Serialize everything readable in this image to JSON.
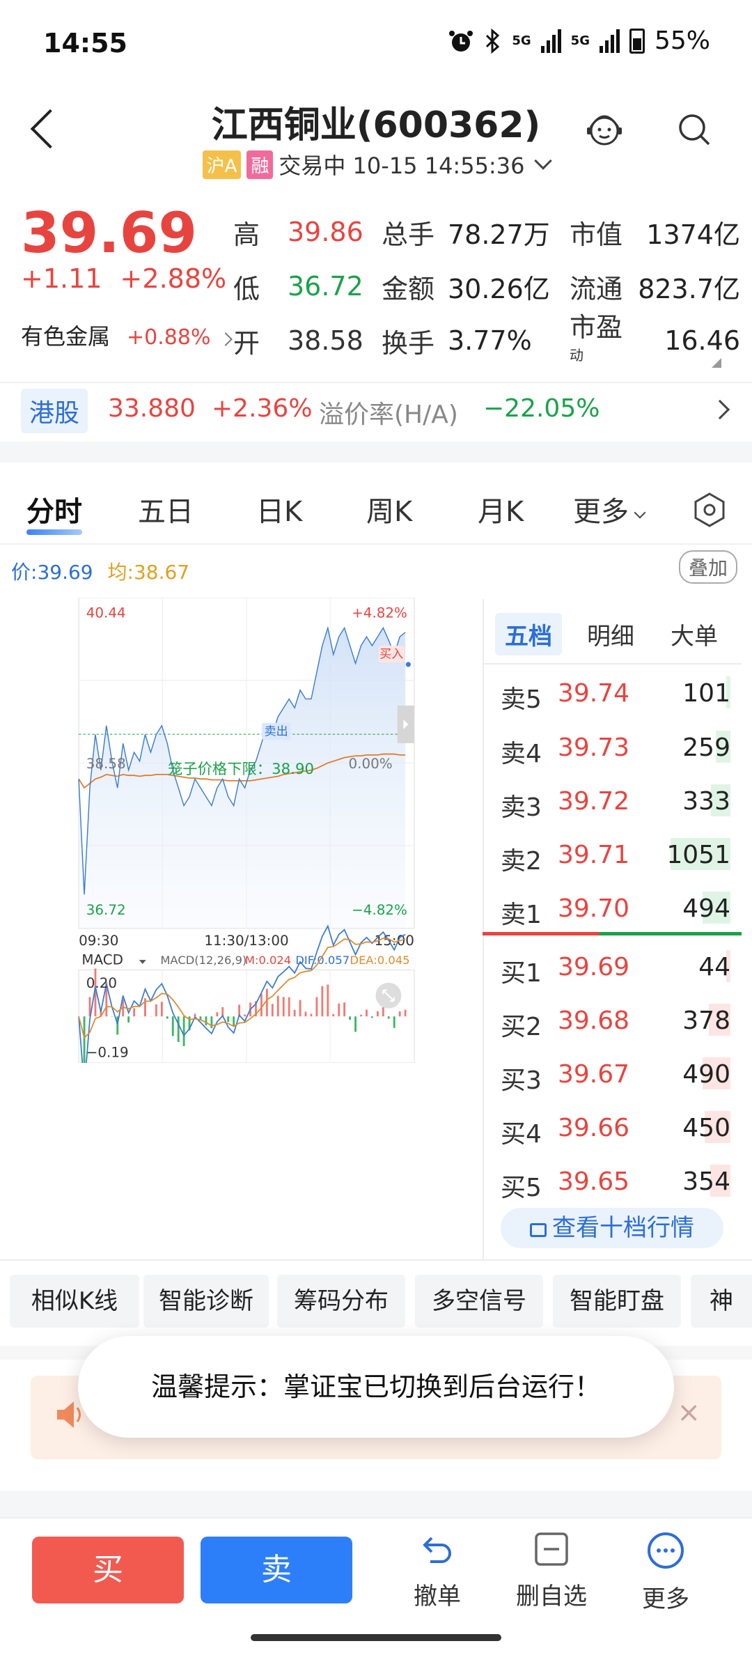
{
  "status": {
    "time": "14:55",
    "battery": "55%",
    "net1": "5G",
    "net2": "5G"
  },
  "header": {
    "title": "江西铜业(600362)",
    "tag_a": "沪A",
    "tag_r": "融",
    "status_text": "交易中 10-15 14:55:36"
  },
  "quote": {
    "price": "39.69",
    "change": "+1.11",
    "change_pct": "+2.88%",
    "sector": "有色金属",
    "sector_pct": "+0.88%",
    "rows": [
      {
        "l1": "高",
        "v1": "39.86",
        "l2": "总手",
        "v2": "78.27万",
        "l3": "市值",
        "v3": "1374亿"
      },
      {
        "l1": "低",
        "v1": "36.72",
        "l2": "金额",
        "v2": "30.26亿",
        "l3": "流通",
        "v3": "823.7亿"
      },
      {
        "l1": "开",
        "v1": "38.58",
        "l2": "换手",
        "v2": "3.77%",
        "l3": "市盈",
        "l3sup": "动",
        "v3": "16.46"
      }
    ]
  },
  "hk": {
    "label": "港股",
    "price": "33.880",
    "pct": "+2.36%",
    "premium_label": "溢价率(H/A)",
    "premium": "−22.05%"
  },
  "tabs": [
    "分时",
    "五日",
    "日K",
    "周K",
    "月K",
    "更多"
  ],
  "priceline": {
    "price_label": "价:",
    "price": "39.69",
    "avg_label": "均:",
    "avg": "38.67",
    "overlay": "叠加"
  },
  "chart_data": {
    "type": "line",
    "y_top": "40.44",
    "y_mid": "38.58",
    "y_bottom": "36.72",
    "pct_top": "+4.82%",
    "pct_mid": "0.00%",
    "pct_bottom": "−4.82%",
    "x_labels": [
      "09:30",
      "11:30/13:00",
      "15:00"
    ],
    "ylim": [
      36.72,
      40.44
    ],
    "cage_label": "笼子价格下限：38.90",
    "buy_mark": "买入",
    "sell_mark": "卖出",
    "series": [
      {
        "values": [
          38.4,
          37.1,
          38.3,
          38.9,
          38.5,
          39.0,
          38.6,
          38.3,
          38.8,
          38.5,
          38.7,
          38.6,
          38.9,
          38.7,
          38.9,
          39.0,
          38.8,
          38.5,
          38.3,
          38.1,
          38.2,
          38.4,
          38.3,
          38.2,
          38.1,
          38.3,
          38.4,
          38.2,
          38.1,
          38.4,
          38.3,
          38.5,
          38.6,
          38.8,
          39.0,
          38.9,
          39.1,
          39.2,
          39.3,
          39.2,
          39.4,
          39.3,
          39.3,
          39.6,
          39.9,
          40.1,
          39.8,
          40.0,
          40.1,
          39.9,
          39.7,
          39.9,
          40.0,
          39.9,
          40.0,
          40.1,
          39.96,
          39.8,
          40.0,
          40.05
        ]
      },
      {
        "values": [
          38.4,
          38.3,
          38.35,
          38.4,
          38.42,
          38.45,
          38.44,
          38.43,
          38.45,
          38.44,
          38.44,
          38.43,
          38.44,
          38.44,
          38.45,
          38.45,
          38.45,
          38.44,
          38.43,
          38.42,
          38.41,
          38.41,
          38.4,
          38.4,
          38.39,
          38.39,
          38.39,
          38.38,
          38.38,
          38.38,
          38.38,
          38.38,
          38.39,
          38.4,
          38.41,
          38.42,
          38.43,
          38.45,
          38.46,
          38.47,
          38.48,
          38.49,
          38.5,
          38.52,
          38.55,
          38.58,
          38.6,
          38.62,
          38.64,
          38.65,
          38.66,
          38.66,
          38.67,
          38.67,
          38.67,
          38.68,
          38.68,
          38.68,
          38.67,
          38.67
        ]
      }
    ]
  },
  "macd": {
    "name": "MACD",
    "params": "MACD(12,26,9)",
    "m": "M:0.024",
    "dif": "DIF:0.057",
    "dea": "DEA:0.045",
    "top": "0.20",
    "bottom": "−0.19"
  },
  "book": {
    "tabs": [
      "五档",
      "明细",
      "大单"
    ],
    "asks": [
      {
        "label": "卖5",
        "price": "39.74",
        "vol": "101",
        "frac": 0.05
      },
      {
        "label": "卖4",
        "price": "39.73",
        "vol": "259",
        "frac": 0.25
      },
      {
        "label": "卖3",
        "price": "39.72",
        "vol": "333",
        "frac": 0.32
      },
      {
        "label": "卖2",
        "price": "39.71",
        "vol": "1051",
        "frac": 1.0
      },
      {
        "label": "卖1",
        "price": "39.70",
        "vol": "494",
        "frac": 0.47
      }
    ],
    "bids": [
      {
        "label": "买1",
        "price": "39.69",
        "vol": "44",
        "frac": 0.04
      },
      {
        "label": "买2",
        "price": "39.68",
        "vol": "378",
        "frac": 0.36
      },
      {
        "label": "买3",
        "price": "39.67",
        "vol": "490",
        "frac": 0.47
      },
      {
        "label": "买4",
        "price": "39.66",
        "vol": "450",
        "frac": 0.43
      },
      {
        "label": "买5",
        "price": "39.65",
        "vol": "354",
        "frac": 0.34
      }
    ],
    "more": "查看十档行情"
  },
  "tools": [
    "相似K线",
    "智能诊断",
    "筹码分布",
    "多空信号",
    "智能盯盘",
    "神"
  ],
  "toast": "温馨提示：掌证宝已切换到后台运行！",
  "bottom": {
    "buy": "买",
    "sell": "卖",
    "cancel": "撤单",
    "del": "删自选",
    "more": "更多"
  },
  "colors": {
    "up": "#e8443f",
    "down": "#1aa24a",
    "accent": "#2c6ed6",
    "price_line": "#3a7bd5",
    "avg_line": "#e07b2e"
  }
}
